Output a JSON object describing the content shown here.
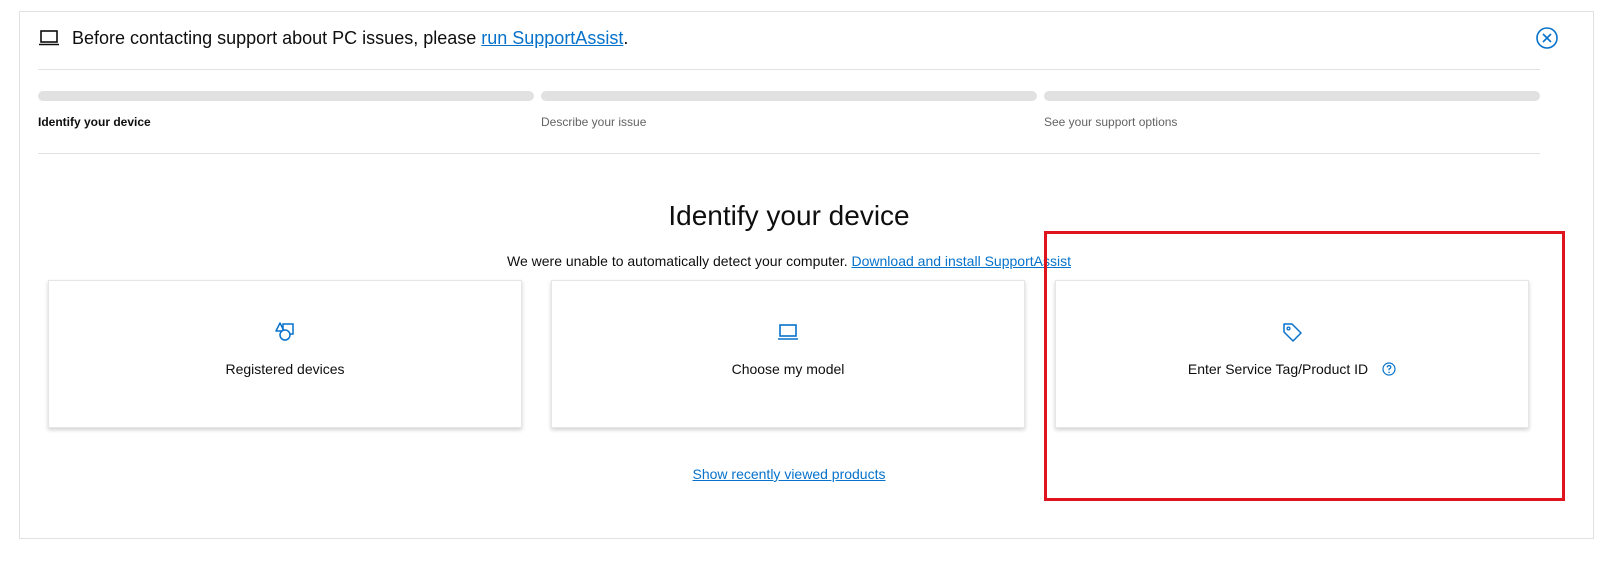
{
  "banner": {
    "text_before": "Before contacting support about PC issues, please ",
    "link": "run SupportAssist",
    "text_after": "."
  },
  "steps": [
    {
      "label": "Identify your device",
      "active": true
    },
    {
      "label": "Describe your issue",
      "active": false
    },
    {
      "label": "See your support options",
      "active": false
    }
  ],
  "main": {
    "heading": "Identify your device",
    "subtext": "We were unable to automatically detect your computer. ",
    "subtext_link": "Download and install SupportAssist"
  },
  "cards": [
    {
      "label": "Registered devices",
      "icon": "shapes-icon"
    },
    {
      "label": "Choose my model",
      "icon": "laptop-icon"
    },
    {
      "label": "Enter Service Tag/Product ID",
      "icon": "tag-icon"
    }
  ],
  "recent_link": "Show recently viewed products",
  "colors": {
    "accent": "#0672cb",
    "highlight": "#e0141e",
    "progress_track": "#e1e1e1"
  }
}
